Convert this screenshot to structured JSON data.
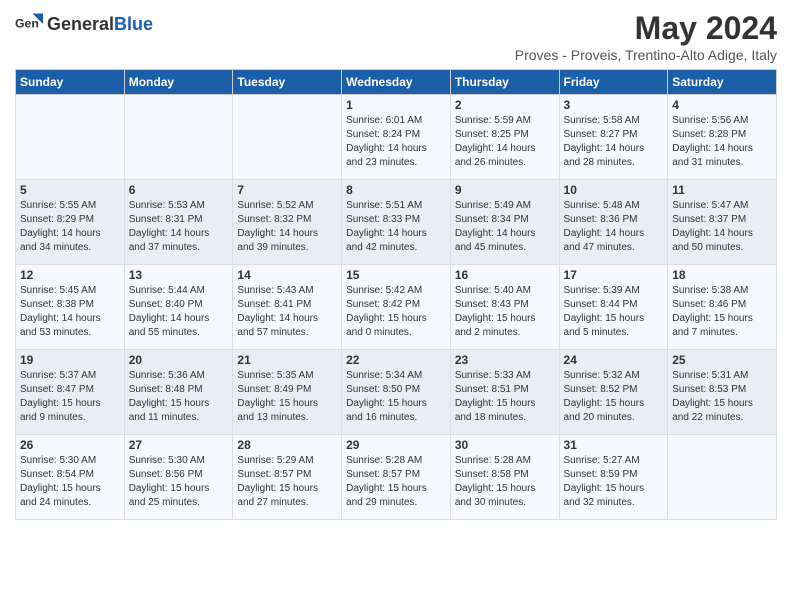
{
  "header": {
    "logo_general": "General",
    "logo_blue": "Blue",
    "month_title": "May 2024",
    "location": "Proves - Proveis, Trentino-Alto Adige, Italy"
  },
  "days_of_week": [
    "Sunday",
    "Monday",
    "Tuesday",
    "Wednesday",
    "Thursday",
    "Friday",
    "Saturday"
  ],
  "weeks": [
    [
      {
        "day": "",
        "info": ""
      },
      {
        "day": "",
        "info": ""
      },
      {
        "day": "",
        "info": ""
      },
      {
        "day": "1",
        "info": "Sunrise: 6:01 AM\nSunset: 8:24 PM\nDaylight: 14 hours\nand 23 minutes."
      },
      {
        "day": "2",
        "info": "Sunrise: 5:59 AM\nSunset: 8:25 PM\nDaylight: 14 hours\nand 26 minutes."
      },
      {
        "day": "3",
        "info": "Sunrise: 5:58 AM\nSunset: 8:27 PM\nDaylight: 14 hours\nand 28 minutes."
      },
      {
        "day": "4",
        "info": "Sunrise: 5:56 AM\nSunset: 8:28 PM\nDaylight: 14 hours\nand 31 minutes."
      }
    ],
    [
      {
        "day": "5",
        "info": "Sunrise: 5:55 AM\nSunset: 8:29 PM\nDaylight: 14 hours\nand 34 minutes."
      },
      {
        "day": "6",
        "info": "Sunrise: 5:53 AM\nSunset: 8:31 PM\nDaylight: 14 hours\nand 37 minutes."
      },
      {
        "day": "7",
        "info": "Sunrise: 5:52 AM\nSunset: 8:32 PM\nDaylight: 14 hours\nand 39 minutes."
      },
      {
        "day": "8",
        "info": "Sunrise: 5:51 AM\nSunset: 8:33 PM\nDaylight: 14 hours\nand 42 minutes."
      },
      {
        "day": "9",
        "info": "Sunrise: 5:49 AM\nSunset: 8:34 PM\nDaylight: 14 hours\nand 45 minutes."
      },
      {
        "day": "10",
        "info": "Sunrise: 5:48 AM\nSunset: 8:36 PM\nDaylight: 14 hours\nand 47 minutes."
      },
      {
        "day": "11",
        "info": "Sunrise: 5:47 AM\nSunset: 8:37 PM\nDaylight: 14 hours\nand 50 minutes."
      }
    ],
    [
      {
        "day": "12",
        "info": "Sunrise: 5:45 AM\nSunset: 8:38 PM\nDaylight: 14 hours\nand 53 minutes."
      },
      {
        "day": "13",
        "info": "Sunrise: 5:44 AM\nSunset: 8:40 PM\nDaylight: 14 hours\nand 55 minutes."
      },
      {
        "day": "14",
        "info": "Sunrise: 5:43 AM\nSunset: 8:41 PM\nDaylight: 14 hours\nand 57 minutes."
      },
      {
        "day": "15",
        "info": "Sunrise: 5:42 AM\nSunset: 8:42 PM\nDaylight: 15 hours\nand 0 minutes."
      },
      {
        "day": "16",
        "info": "Sunrise: 5:40 AM\nSunset: 8:43 PM\nDaylight: 15 hours\nand 2 minutes."
      },
      {
        "day": "17",
        "info": "Sunrise: 5:39 AM\nSunset: 8:44 PM\nDaylight: 15 hours\nand 5 minutes."
      },
      {
        "day": "18",
        "info": "Sunrise: 5:38 AM\nSunset: 8:46 PM\nDaylight: 15 hours\nand 7 minutes."
      }
    ],
    [
      {
        "day": "19",
        "info": "Sunrise: 5:37 AM\nSunset: 8:47 PM\nDaylight: 15 hours\nand 9 minutes."
      },
      {
        "day": "20",
        "info": "Sunrise: 5:36 AM\nSunset: 8:48 PM\nDaylight: 15 hours\nand 11 minutes."
      },
      {
        "day": "21",
        "info": "Sunrise: 5:35 AM\nSunset: 8:49 PM\nDaylight: 15 hours\nand 13 minutes."
      },
      {
        "day": "22",
        "info": "Sunrise: 5:34 AM\nSunset: 8:50 PM\nDaylight: 15 hours\nand 16 minutes."
      },
      {
        "day": "23",
        "info": "Sunrise: 5:33 AM\nSunset: 8:51 PM\nDaylight: 15 hours\nand 18 minutes."
      },
      {
        "day": "24",
        "info": "Sunrise: 5:32 AM\nSunset: 8:52 PM\nDaylight: 15 hours\nand 20 minutes."
      },
      {
        "day": "25",
        "info": "Sunrise: 5:31 AM\nSunset: 8:53 PM\nDaylight: 15 hours\nand 22 minutes."
      }
    ],
    [
      {
        "day": "26",
        "info": "Sunrise: 5:30 AM\nSunset: 8:54 PM\nDaylight: 15 hours\nand 24 minutes."
      },
      {
        "day": "27",
        "info": "Sunrise: 5:30 AM\nSunset: 8:56 PM\nDaylight: 15 hours\nand 25 minutes."
      },
      {
        "day": "28",
        "info": "Sunrise: 5:29 AM\nSunset: 8:57 PM\nDaylight: 15 hours\nand 27 minutes."
      },
      {
        "day": "29",
        "info": "Sunrise: 5:28 AM\nSunset: 8:57 PM\nDaylight: 15 hours\nand 29 minutes."
      },
      {
        "day": "30",
        "info": "Sunrise: 5:28 AM\nSunset: 8:58 PM\nDaylight: 15 hours\nand 30 minutes."
      },
      {
        "day": "31",
        "info": "Sunrise: 5:27 AM\nSunset: 8:59 PM\nDaylight: 15 hours\nand 32 minutes."
      },
      {
        "day": "",
        "info": ""
      }
    ]
  ]
}
